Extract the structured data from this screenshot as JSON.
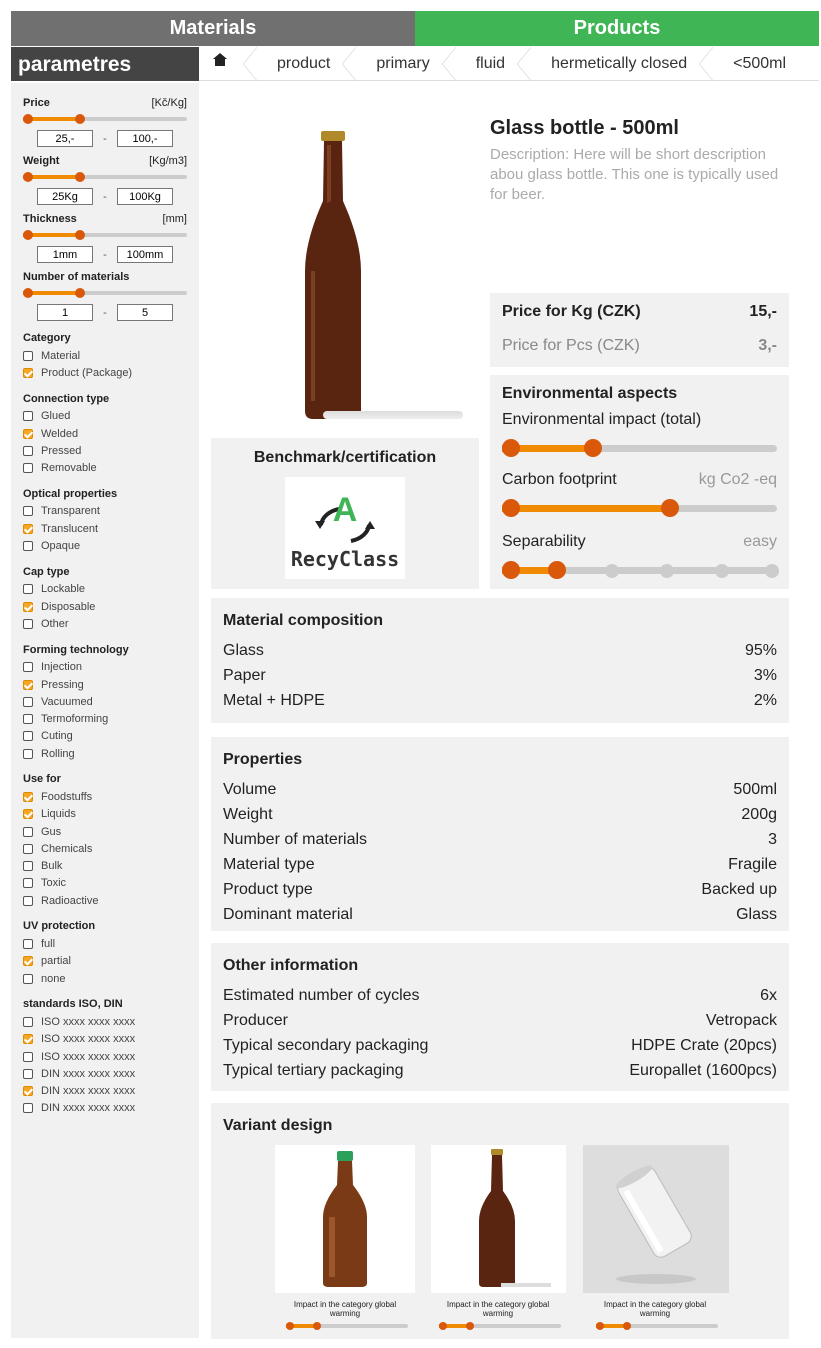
{
  "top_tabs": {
    "materials": "Materials",
    "products": "Products"
  },
  "sidebar_title": "parametres",
  "breadcrumb": [
    "product",
    "primary",
    "fluid",
    "hermetically closed",
    "<500ml"
  ],
  "ranges": [
    {
      "label": "Price",
      "unit": "[Kč/Kg]",
      "min": "25,-",
      "max": "100,-",
      "low": 0,
      "high": 0.35
    },
    {
      "label": "Weight",
      "unit": "[Kg/m3]",
      "min": "25Kg",
      "max": "100Kg",
      "low": 0,
      "high": 0.35
    },
    {
      "label": "Thickness",
      "unit": "[mm]",
      "min": "1mm",
      "max": "100mm",
      "low": 0,
      "high": 0.35
    },
    {
      "label": "Number of materials",
      "unit": "",
      "min": "1",
      "max": "5",
      "low": 0,
      "high": 0.35
    }
  ],
  "filter_groups": [
    {
      "title": "Category",
      "items": [
        {
          "label": "Material",
          "checked": false
        },
        {
          "label": "Product (Package)",
          "checked": true
        }
      ]
    },
    {
      "title": "Connection type",
      "items": [
        {
          "label": "Glued",
          "checked": false
        },
        {
          "label": "Welded",
          "checked": true
        },
        {
          "label": "Pressed",
          "checked": false
        },
        {
          "label": "Removable",
          "checked": false
        }
      ]
    },
    {
      "title": "Optical properties",
      "items": [
        {
          "label": "Transparent",
          "checked": false
        },
        {
          "label": "Translucent",
          "checked": true
        },
        {
          "label": "Opaque",
          "checked": false
        }
      ]
    },
    {
      "title": "Cap type",
      "items": [
        {
          "label": "Lockable",
          "checked": false
        },
        {
          "label": "Disposable",
          "checked": true
        },
        {
          "label": "Other",
          "checked": false
        }
      ]
    },
    {
      "title": "Forming technology",
      "items": [
        {
          "label": "Injection",
          "checked": false
        },
        {
          "label": "Pressing",
          "checked": true
        },
        {
          "label": "Vacuumed",
          "checked": false
        },
        {
          "label": "Termoforming",
          "checked": false
        },
        {
          "label": "Cuting",
          "checked": false
        },
        {
          "label": "Rolling",
          "checked": false
        }
      ]
    },
    {
      "title": "Use for",
      "items": [
        {
          "label": "Foodstuffs",
          "checked": true
        },
        {
          "label": "Liquids",
          "checked": true
        },
        {
          "label": "Gus",
          "checked": false
        },
        {
          "label": "Chemicals",
          "checked": false
        },
        {
          "label": "Bulk",
          "checked": false
        },
        {
          "label": "Toxic",
          "checked": false
        },
        {
          "label": "Radioactive",
          "checked": false
        }
      ]
    },
    {
      "title": "UV protection",
      "items": [
        {
          "label": "full",
          "checked": false
        },
        {
          "label": "partial",
          "checked": true
        },
        {
          "label": "none",
          "checked": false
        }
      ]
    },
    {
      "title": "standards ISO, DIN",
      "items": [
        {
          "label": "ISO xxxx xxxx xxxx",
          "checked": false
        },
        {
          "label": "ISO xxxx xxxx xxxx",
          "checked": true
        },
        {
          "label": "ISO xxxx xxxx xxxx",
          "checked": false
        },
        {
          "label": "DIN xxxx xxxx xxxx",
          "checked": false
        },
        {
          "label": "DIN xxxx xxxx xxxx",
          "checked": true
        },
        {
          "label": "DIN xxxx xxxx xxxx",
          "checked": false
        }
      ]
    }
  ],
  "product": {
    "title": "Glass bottle - 500ml",
    "description": "Description: Here will be short description abou glass bottle. This one is typically used for beer."
  },
  "price": {
    "kg_label": "Price for Kg (CZK)",
    "kg_value": "15,-",
    "pcs_label": "Price for Pcs (CZK)",
    "pcs_value": "3,-"
  },
  "benchmark": {
    "title": "Benchmark/certification",
    "logo_letter": "A",
    "logo_text": "RecyClass"
  },
  "environment": {
    "title": "Environmental aspects",
    "impact_label": "Environmental impact (total)",
    "impact_level": 0.33,
    "carbon_label": "Carbon footprint",
    "carbon_unit": "kg Co2 -eq",
    "carbon_level": 0.61,
    "separability_label": "Separability",
    "separability_value": "easy",
    "separability_level": 0.2
  },
  "composition": {
    "title": "Material composition",
    "rows": [
      {
        "k": "Glass",
        "v": "95%"
      },
      {
        "k": "Paper",
        "v": "3%"
      },
      {
        "k": "Metal + HDPE",
        "v": "2%"
      }
    ]
  },
  "properties": {
    "title": "Properties",
    "rows": [
      {
        "k": "Volume",
        "v": "500ml"
      },
      {
        "k": "Weight",
        "v": "200g"
      },
      {
        "k": "Number of materials",
        "v": "3"
      },
      {
        "k": "Material type",
        "v": "Fragile"
      },
      {
        "k": "Product type",
        "v": "Backed up"
      },
      {
        "k": "Dominant material",
        "v": "Glass"
      }
    ]
  },
  "other_info": {
    "title": "Other information",
    "rows": [
      {
        "k": "Estimated number of cycles",
        "v": "6x"
      },
      {
        "k": "Producer",
        "v": "Vetropack"
      },
      {
        "k": "Typical secondary packaging",
        "v": "HDPE Crate (20pcs)"
      },
      {
        "k": "Typical tertiary packaging",
        "v": "Europallet (1600pcs)"
      }
    ]
  },
  "variant": {
    "title": "Variant design",
    "items": [
      {
        "caption": "Impact in the category global warming",
        "level": 0.25
      },
      {
        "caption": "Impact in the category global warming",
        "level": 0.25
      },
      {
        "caption": "Impact in the category global warming",
        "level": 0.25
      }
    ]
  },
  "colors": {
    "accent": "#f08a00",
    "knob": "#d9580a",
    "products_tab": "#3fb556",
    "materials_tab": "#707070"
  }
}
